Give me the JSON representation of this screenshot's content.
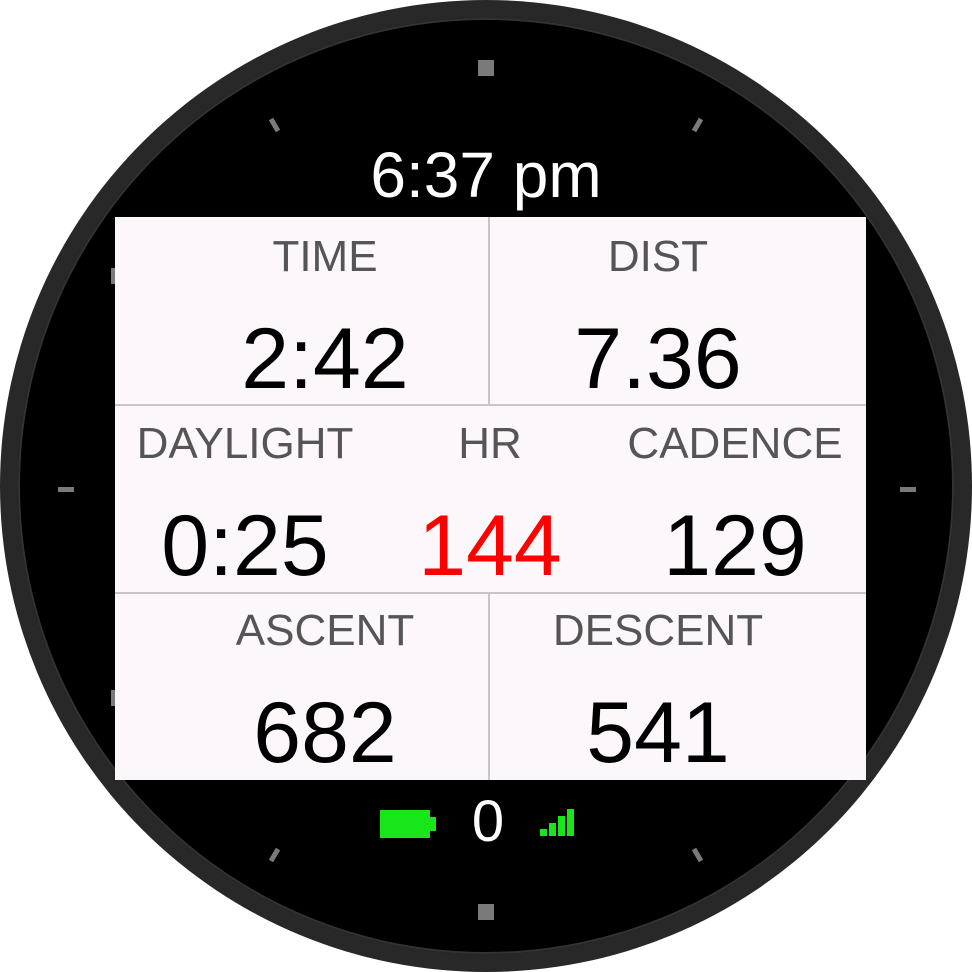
{
  "header": {
    "clock": "6:37 pm"
  },
  "fields": {
    "time": {
      "label": "TIME",
      "value": "2:42"
    },
    "dist": {
      "label": "DIST",
      "value": "7.36"
    },
    "daylight": {
      "label": "DAYLIGHT",
      "value": "0:25"
    },
    "hr": {
      "label": "HR",
      "value": "144"
    },
    "cadence": {
      "label": "CADENCE",
      "value": "129"
    },
    "ascent": {
      "label": "ASCENT",
      "value": "682"
    },
    "descent": {
      "label": "DESCENT",
      "value": "541"
    }
  },
  "status_bar": {
    "battery_icon": "battery-full-icon",
    "notification_count": "0",
    "signal_icon": "signal-strength-icon"
  },
  "colors": {
    "background": "#000000",
    "panel": "#fbf7fb",
    "label": "#555555",
    "value": "#000000",
    "hr_value": "#ff0000",
    "status_green": "#19e619"
  }
}
